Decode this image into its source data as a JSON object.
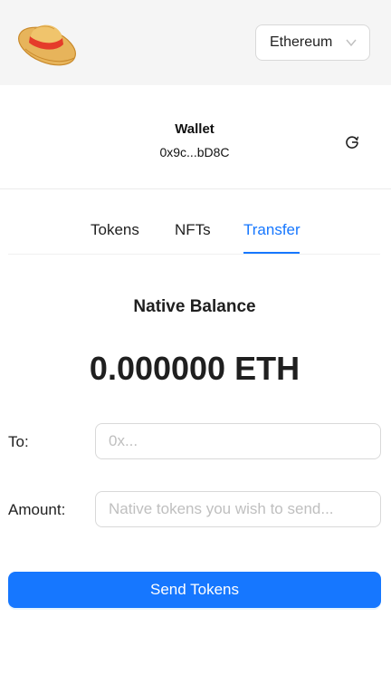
{
  "header": {
    "logo_icon": "straw-hat-icon",
    "network_select": {
      "value": "Ethereum",
      "icon": "chevron-down-icon"
    }
  },
  "wallet": {
    "title": "Wallet",
    "address": "0x9c...bD8C",
    "refresh_icon": "reload-icon"
  },
  "tabs": [
    {
      "label": "Tokens",
      "active": false
    },
    {
      "label": "NFTs",
      "active": false
    },
    {
      "label": "Transfer",
      "active": true
    }
  ],
  "balance": {
    "label": "Native Balance",
    "value": "0.000000 ETH"
  },
  "transfer_form": {
    "to_label": "To:",
    "to_placeholder": "0x...",
    "to_value": "",
    "amount_label": "Amount:",
    "amount_placeholder": "Native tokens you wish to send...",
    "amount_value": "",
    "submit_label": "Send Tokens"
  },
  "colors": {
    "accent": "#1677ff",
    "header_bg": "#f5f5f5",
    "text": "#1f1f1f"
  }
}
